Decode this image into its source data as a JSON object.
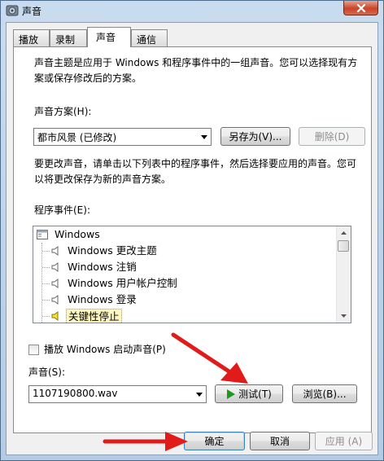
{
  "window": {
    "title": "声音"
  },
  "tabs": [
    {
      "label": "播放"
    },
    {
      "label": "录制"
    },
    {
      "label": "声音"
    },
    {
      "label": "通信"
    }
  ],
  "sounds_tab": {
    "intro": [
      "声音主题是应用于 Windows 和程序事件中的一组声音。您可以选择现有方",
      "案或保存修改后的方案。"
    ],
    "scheme_label": "声音方案(H):",
    "scheme_value": "都市风景 (已修改)",
    "save_as_label": "另存为(V)...",
    "delete_label": "删除(D)",
    "change_text": [
      "要更改声音，请单击以下列表中的程序事件，然后选择要应用的声音。您可",
      "以将更改保存为新的声音方案。"
    ],
    "events_label": "程序事件(E):",
    "events": [
      {
        "label": "Windows"
      },
      {
        "label": "Windows 更改主题"
      },
      {
        "label": "Windows 注销"
      },
      {
        "label": "Windows 用户帐户控制"
      },
      {
        "label": "Windows 登录"
      },
      {
        "label": "关键性停止"
      }
    ],
    "startup_checkbox_label": "播放 Windows 启动声音(P)",
    "sound_label": "声音(S):",
    "sound_value": "1107190800.wav",
    "test_label": "测试(T)",
    "browse_label": "浏览(B)..."
  },
  "footer": {
    "ok_label": "确定",
    "cancel_label": "取消",
    "apply_label": "应用 (A)"
  },
  "colors": {
    "annotation_arrow": "#e11a1a",
    "selected_item": "#fff7c2",
    "test_play_icon": "#1b9a1b"
  }
}
